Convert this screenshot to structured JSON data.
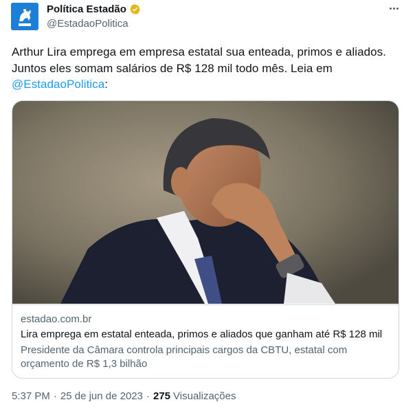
{
  "account": {
    "display_name": "Política Estadão",
    "handle": "@EstadaoPolitica",
    "avatar_icon": "estadao-politica-logo",
    "verified_badge": "gold-verified-icon",
    "avatar_color": "#1d7fd6"
  },
  "tweet": {
    "text": "Arthur Lira emprega em empresa estatal sua enteada, primos e aliados. Juntos eles somam salários de R$ 128 mil todo mês. Leia em ",
    "mention": "@EstadaoPolitica",
    "text_end": ":"
  },
  "card": {
    "image_icon": "news-photo",
    "domain": "estadao.com.br",
    "title": "Lira emprega em estatal enteada, primos e aliados que ganham até R$ 128 mil",
    "description": "Presidente da Câmara controla principais cargos da CBTU, estatal com orçamento de R$ 1,3 bilhão"
  },
  "meta": {
    "time": "5:37 PM",
    "separator": "·",
    "date": "25 de jun de 2023",
    "views_count": "275",
    "views_label": "Visualizações"
  },
  "colors": {
    "link": "#1d9bf0",
    "secondary_text": "#536471",
    "primary_text": "#0f1419",
    "border": "#cfd9de"
  }
}
